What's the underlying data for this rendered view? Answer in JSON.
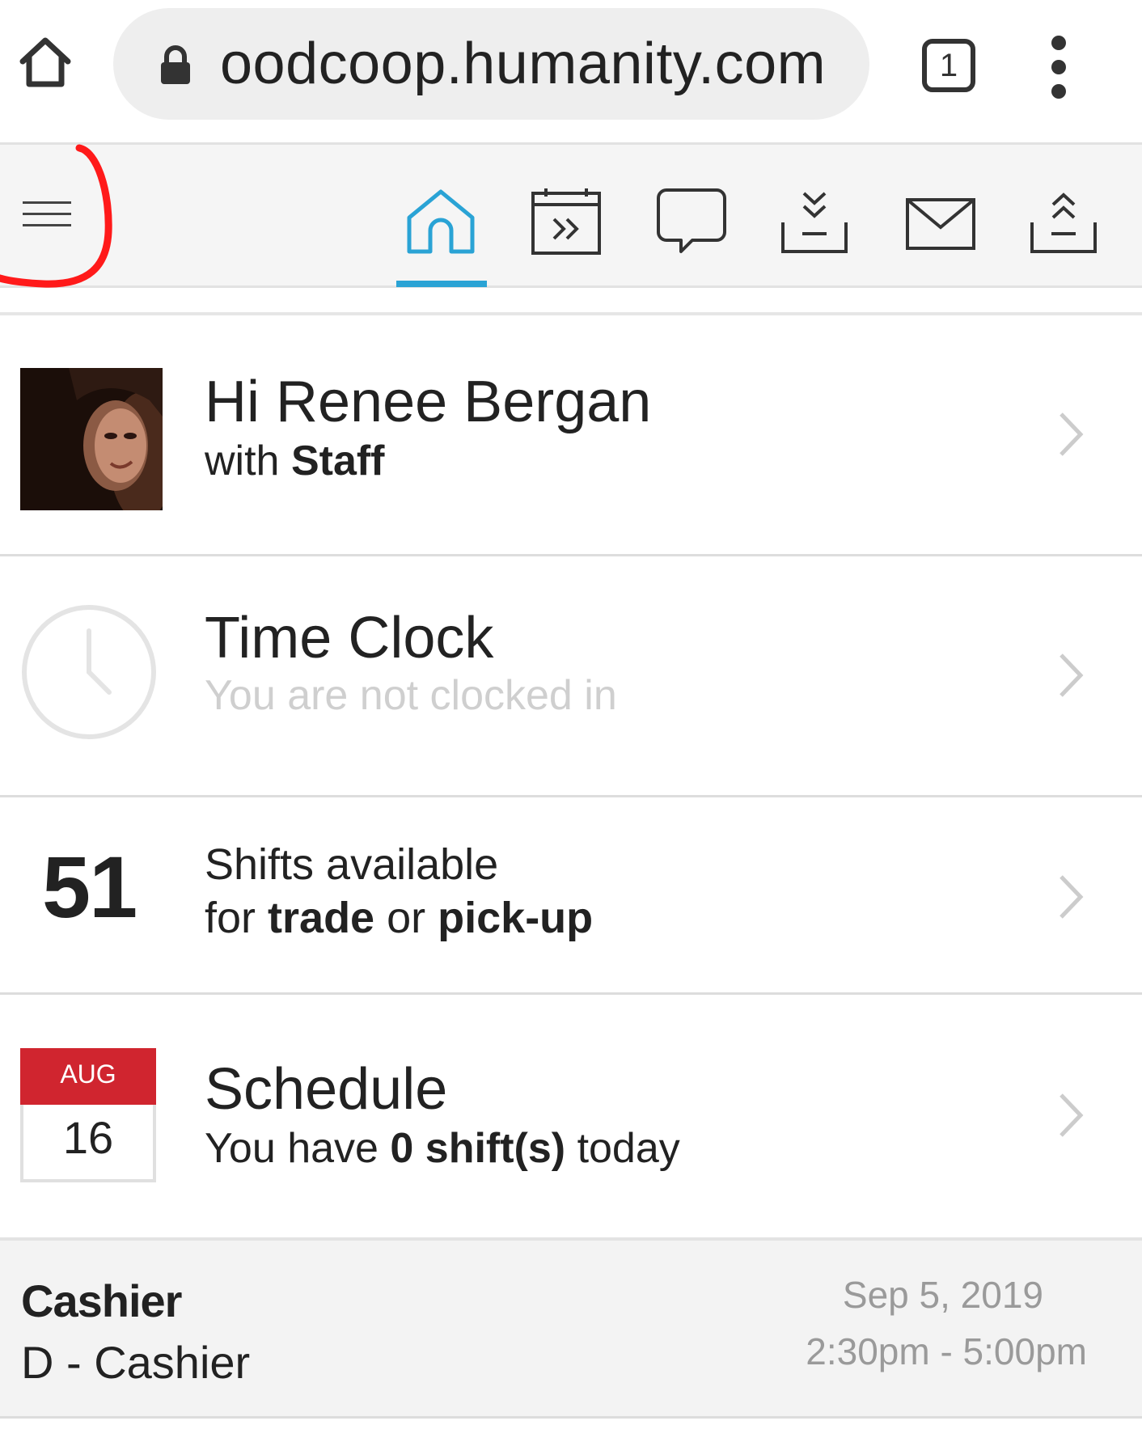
{
  "browser": {
    "url": "oodcoop.humanity.com",
    "tab_count": "1"
  },
  "toolbar": {
    "icons": [
      "home-icon",
      "schedule-icon",
      "messages-icon",
      "download-icon",
      "mail-icon",
      "upload-icon"
    ],
    "active": "home-icon",
    "accent_color": "#2aa3d5",
    "annotation_color": "#ff1a1a"
  },
  "greeting": {
    "title": "Hi Renee Bergan",
    "with_label": "with",
    "group": "Staff"
  },
  "time_clock": {
    "title": "Time Clock",
    "status": "You are not clocked in"
  },
  "shifts_available": {
    "count": "51",
    "line1": "Shifts available",
    "for_label": "for",
    "trade_label": "trade",
    "or_label": "or",
    "pickup_label": "pick-up"
  },
  "schedule": {
    "title": "Schedule",
    "calendar_month": "AUG",
    "calendar_day": "16",
    "prefix": "You have",
    "count_text": "0 shift(s)",
    "suffix": "today",
    "calendar_color": "#d0252f"
  },
  "shift": {
    "position": "Cashier",
    "detail": "D - Cashier",
    "date": "Sep 5, 2019",
    "time": "2:30pm - 5:00pm"
  }
}
